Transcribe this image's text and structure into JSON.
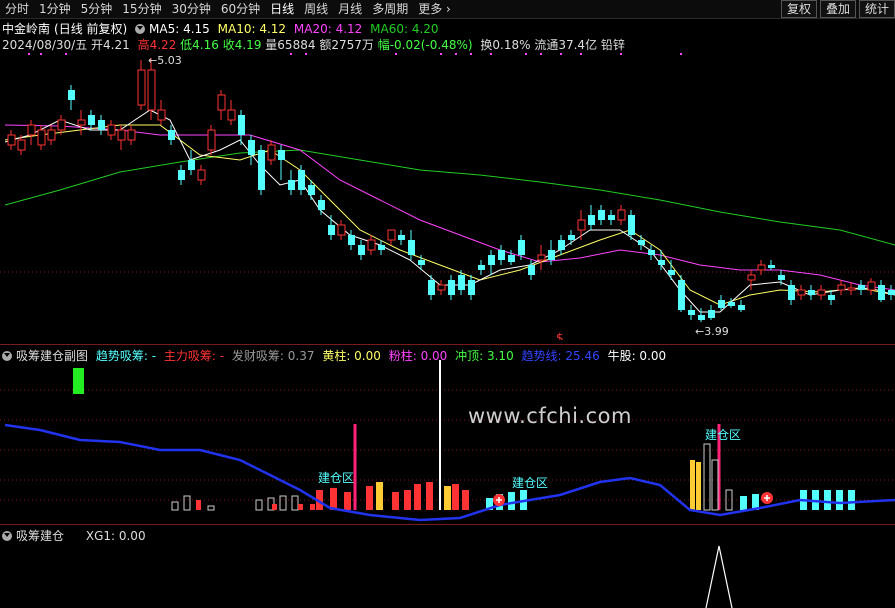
{
  "toolbar": {
    "tabs": [
      "分时",
      "1分钟",
      "5分钟",
      "15分钟",
      "30分钟",
      "60分钟",
      "日线",
      "周线",
      "月线",
      "多周期",
      "更多"
    ],
    "right_buttons": [
      "复权",
      "叠加",
      "统计"
    ]
  },
  "info": {
    "stock_name": "中金岭南",
    "mode": "(日线 前复权)",
    "ma5": "MA5: 4.15",
    "ma10": "MA10: 4.12",
    "ma20": "MA20: 4.12",
    "ma60": "MA60: 4.20",
    "date": "2024/08/30/五",
    "open": "开4.21",
    "high": "高4.22",
    "low": "低4.16",
    "close": "收4.19",
    "volume": "量65884",
    "amount": "额2757万",
    "change": "幅-0.02(-0.48%)",
    "turnover": "换0.18%",
    "float": "流通37.4亿",
    "sector": "铅锌"
  },
  "price_labels": {
    "high_mark": "5.03",
    "low_mark": "3.99",
    "dollar": "$"
  },
  "sub1": {
    "title": "吸筹建仓副图",
    "trend": "趋势吸筹: -",
    "main": "主力吸筹: -",
    "fortune": "发财吸筹: 0.37",
    "yellow": "黄柱: 0.00",
    "pink": "粉柱: 0.00",
    "top": "冲顶: 3.10",
    "trendline": "趋势线: 25.46",
    "bull": "牛股: 0.00",
    "zone1": "建仓区",
    "zone2": "建仓区",
    "zone3": "建仓区"
  },
  "sub2": {
    "title": "吸筹建仓",
    "xg": "XG1: 0.00"
  },
  "watermark": "www.cfchi.com",
  "colors": {
    "up": "#ff3333",
    "down": "#54ffff",
    "ma5": "#ffffff",
    "ma10": "#ffff66",
    "ma20": "#ff44ff",
    "ma60": "#22cc22",
    "trend": "#2233ee"
  }
}
